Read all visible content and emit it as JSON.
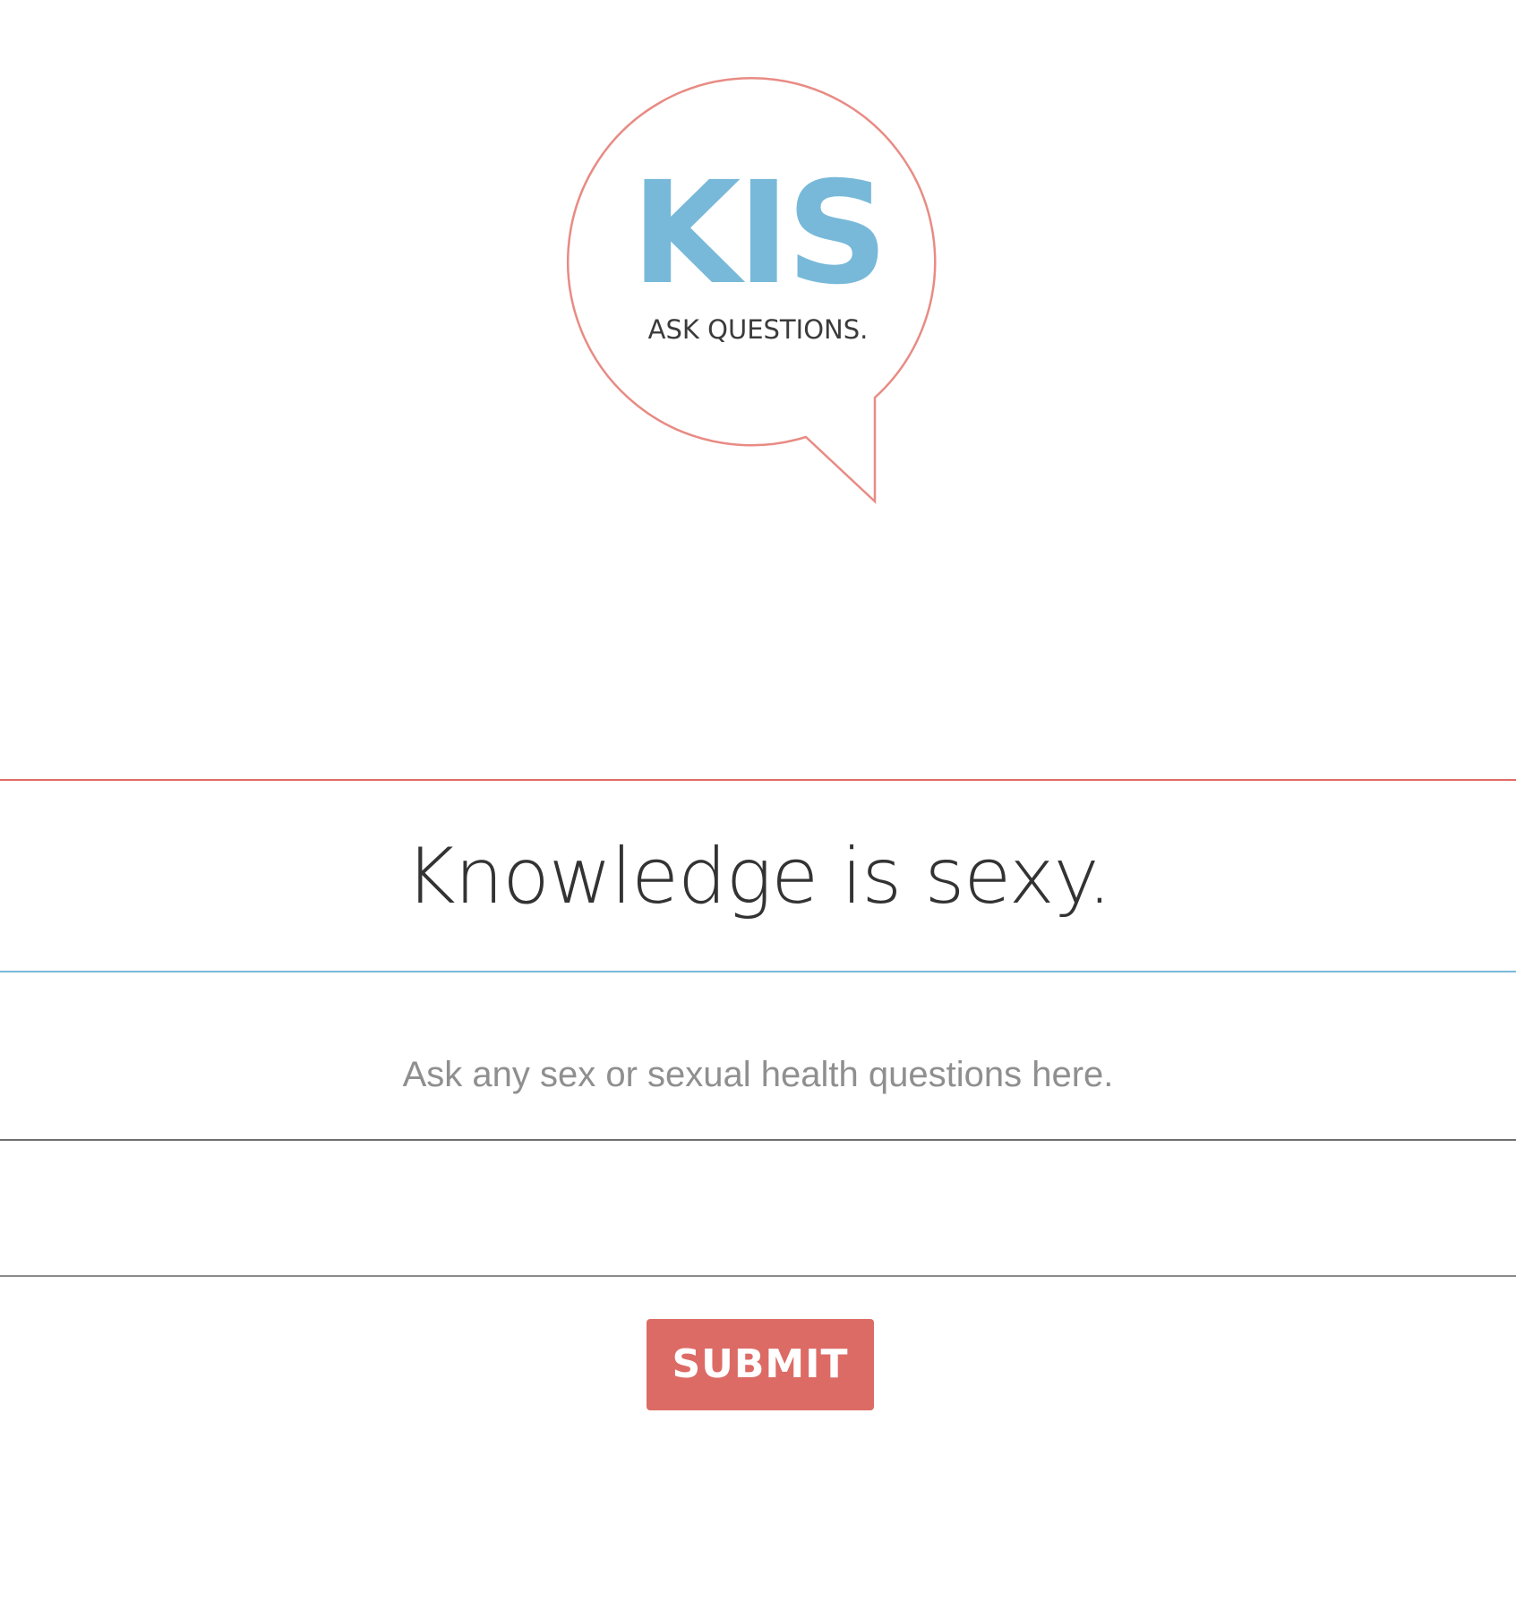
{
  "logo": {
    "icon": "speech-bubble-icon",
    "main_text": "KIS",
    "tagline": "ASK QUESTIONS.",
    "text_color": "#78b9d9",
    "outline_color": "#e88b84"
  },
  "hero": {
    "headline": "Knowledge is sexy.",
    "top_rule_color": "#e06c66",
    "bottom_rule_color": "#78b9d9"
  },
  "question_form": {
    "question_placeholder": "Ask any sex or sexual health questions here.",
    "question_value": "",
    "submit_label": "SUBMIT",
    "submit_color": "#dd6b65"
  }
}
